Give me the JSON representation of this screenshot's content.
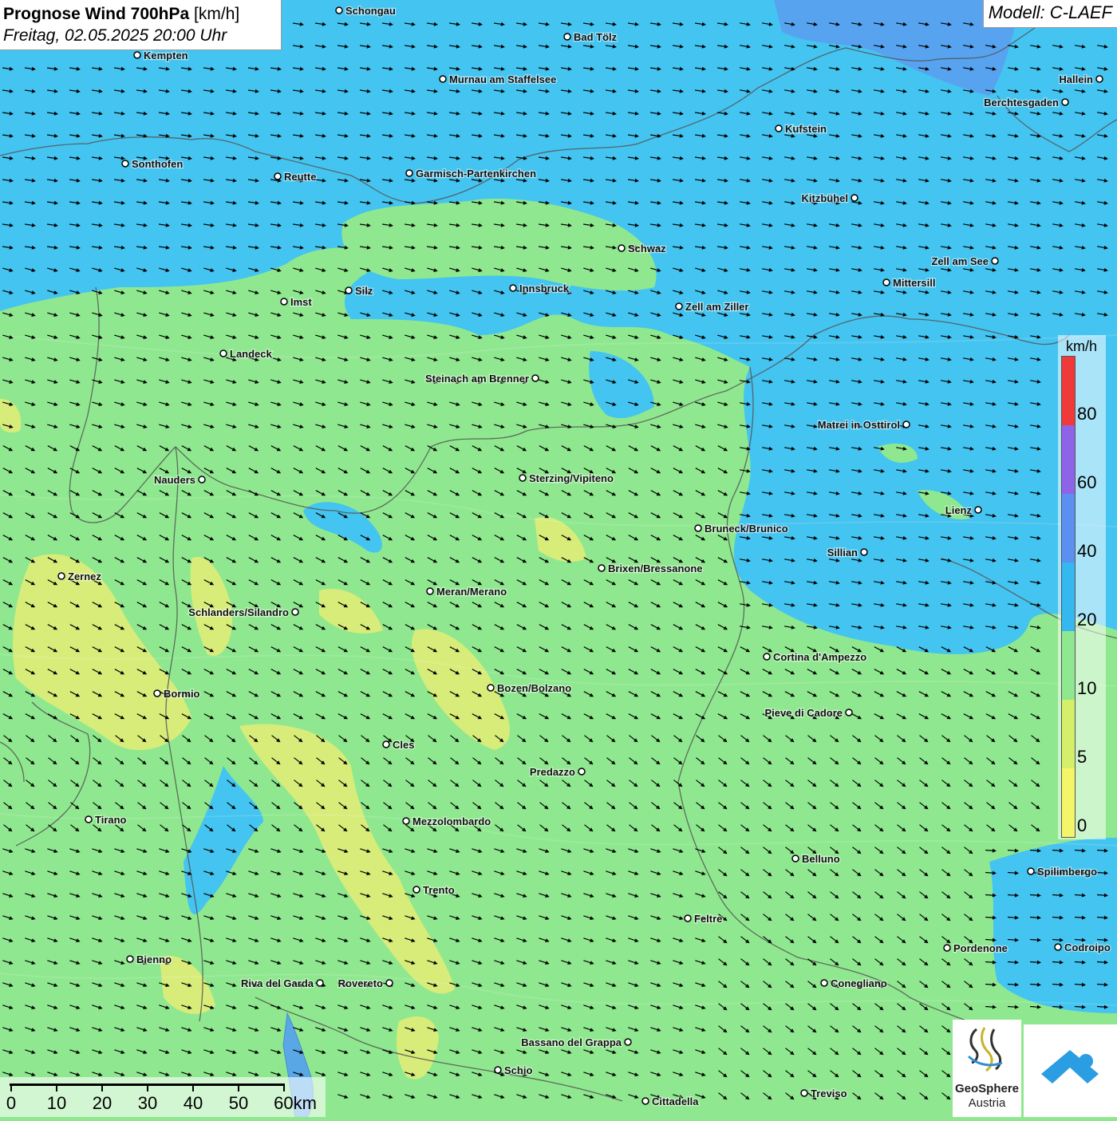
{
  "header": {
    "title_bold": "Prognose Wind 700hPa",
    "title_unit": "[km/h]",
    "subtitle": "Freitag, 02.05.2025 20:00 Uhr",
    "model": "Modell: C-LAEF"
  },
  "legend": {
    "unit": "km/h",
    "ticks": [
      "80",
      "60",
      "40",
      "20",
      "10",
      "5",
      "0"
    ],
    "colors": [
      "#f03a3a",
      "#8f63e8",
      "#5b8ff0",
      "#35b7ef",
      "#8fe88f",
      "#d4f06a",
      "#f5f56a"
    ]
  },
  "scale": {
    "labels": [
      "0",
      "10",
      "20",
      "30",
      "40",
      "50",
      "60km"
    ]
  },
  "colors": {
    "calm_yellow": "#d8ec7a",
    "light_green": "#8fe88f",
    "sky_blue": "#44c4f0",
    "mid_blue": "#5a9df0",
    "border_line": "#555555",
    "arrow": "#000000"
  },
  "cities": [
    {
      "name": "Schongau"
    },
    {
      "name": "Bad Tölz"
    },
    {
      "name": "Kempten"
    },
    {
      "name": "Murnau am Staffelsee"
    },
    {
      "name": "Hallein"
    },
    {
      "name": "Berchtesgaden"
    },
    {
      "name": "Kufstein"
    },
    {
      "name": "Sonthofen"
    },
    {
      "name": "Reutte"
    },
    {
      "name": "Garmisch-Partenkirchen"
    },
    {
      "name": "Kitzbühel"
    },
    {
      "name": "Schwaz"
    },
    {
      "name": "Zell am See"
    },
    {
      "name": "Mittersill"
    },
    {
      "name": "Innsbruck"
    },
    {
      "name": "Silz"
    },
    {
      "name": "Imst"
    },
    {
      "name": "Zell am Ziller"
    },
    {
      "name": "Landeck"
    },
    {
      "name": "Steinach am Brenner"
    },
    {
      "name": "Matrei in Osttirol"
    },
    {
      "name": "Nauders"
    },
    {
      "name": "Sterzing/Vipiteno"
    },
    {
      "name": "Lienz"
    },
    {
      "name": "Bruneck/Brunico"
    },
    {
      "name": "Sillian"
    },
    {
      "name": "Zernez"
    },
    {
      "name": "Brixen/Bressanone"
    },
    {
      "name": "Meran/Merano"
    },
    {
      "name": "Schlanders/Silandro"
    },
    {
      "name": "Cortina d'Ampezzo"
    },
    {
      "name": "Bormio"
    },
    {
      "name": "Bozen/Bolzano"
    },
    {
      "name": "Pieve di Cadore"
    },
    {
      "name": "Cles"
    },
    {
      "name": "Predazzo"
    },
    {
      "name": "Tirano"
    },
    {
      "name": "Mezzolombardo"
    },
    {
      "name": "Belluno"
    },
    {
      "name": "Spilimbergo"
    },
    {
      "name": "Trento"
    },
    {
      "name": "Feltre"
    },
    {
      "name": "Pordenone"
    },
    {
      "name": "Codroipo"
    },
    {
      "name": "Bienno"
    },
    {
      "name": "Riva del Garda"
    },
    {
      "name": "Rovereto"
    },
    {
      "name": "Conegliano"
    },
    {
      "name": "Bassano del Grappa"
    },
    {
      "name": "Schio"
    },
    {
      "name": "Treviso"
    },
    {
      "name": "Cittadella"
    }
  ],
  "logo": {
    "line1": "GeoSphere",
    "line2": "Austria"
  }
}
